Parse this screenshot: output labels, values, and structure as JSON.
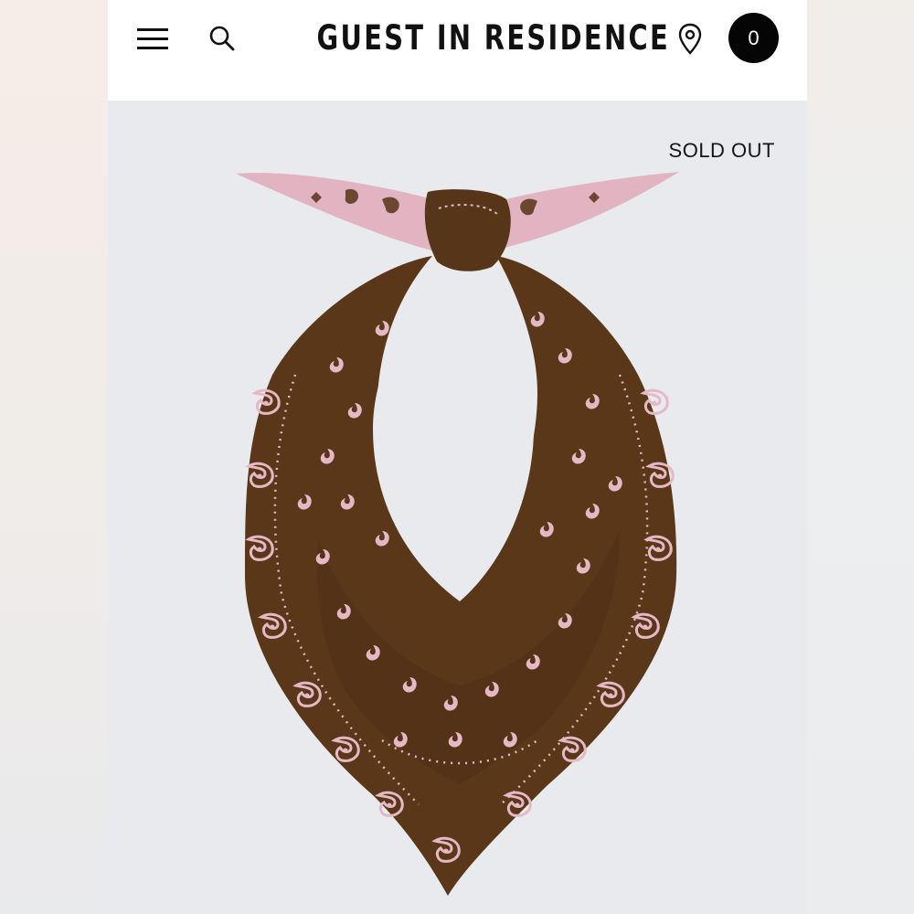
{
  "header": {
    "brand": "GUEST IN RESIDENCE",
    "cart_count": "0",
    "icons": {
      "menu": "hamburger-menu-icon",
      "search": "search-icon",
      "location": "location-pin-icon"
    }
  },
  "product": {
    "badge": "SOLD OUT",
    "image_description": "brown-pink-paisley-bandana-scarf"
  },
  "colors": {
    "header_bg": "#ffffff",
    "image_bg": "#e8eaed",
    "cart_bg": "#050505",
    "scarf_brown": "#5a3719",
    "scarf_pink": "#e6b7c4"
  }
}
